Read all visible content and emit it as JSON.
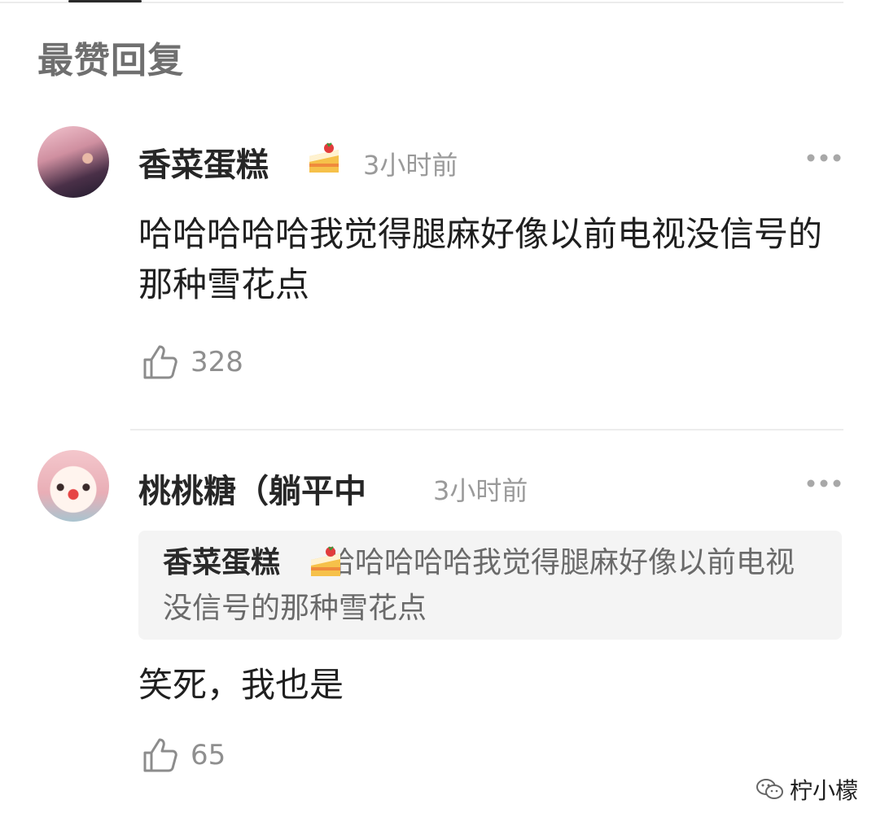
{
  "section_title": "最赞回复",
  "comments": [
    {
      "username": "香菜蛋糕",
      "time": "3小时前",
      "text": "哈哈哈哈哈我觉得腿麻好像以前电视没信号的那种雪花点",
      "likes": "328"
    },
    {
      "username": "桃桃糖（躺平中",
      "time": "3小时前",
      "quote_user": "香菜蛋糕",
      "quote_text": "哈哈哈哈哈我觉得腿麻好像以前电视没信号的那种雪花点",
      "text": "笑死，我也是",
      "likes": "65"
    }
  ],
  "watermark": "柠小檬",
  "icons": {
    "badge": "cake-icon",
    "more": "more-dots-icon",
    "like": "thumbs-up-icon",
    "watermark": "wechat-icon"
  },
  "colors": {
    "section_title": "#6f6f6f",
    "meta": "#9a9a9a",
    "quote_bg": "#f4f4f4",
    "divider": "#ececec"
  }
}
